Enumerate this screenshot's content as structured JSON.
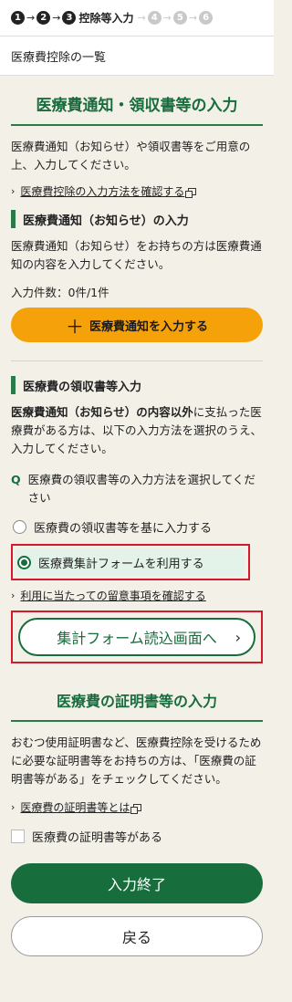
{
  "steps": [
    {
      "num": "1",
      "active": true
    },
    {
      "num": "2",
      "active": true
    },
    {
      "num": "3",
      "active": true,
      "label": "控除等入力"
    },
    {
      "num": "4",
      "active": false
    },
    {
      "num": "5",
      "active": false
    },
    {
      "num": "6",
      "active": false
    }
  ],
  "breadcrumb": "医療費控除の一覧",
  "notice_section": {
    "title": "医療費通知・領収書等の入力",
    "intro": "医療費通知（お知らせ）や領収書等をご用意の上、入力してください。",
    "link_how_to": "医療費控除の入力方法を確認する"
  },
  "notice_sub": {
    "heading": "医療費通知（お知らせ）の入力",
    "text": "医療費通知（お知らせ）をお持ちの方は医療費通知の内容を入力してください。",
    "count": "入力件数：0件/1件",
    "input_button": "医療費通知を入力する"
  },
  "receipt_sub": {
    "heading": "医療費の領収書等入力",
    "text_bold": "医療費通知（お知らせ）の内容以外",
    "text_rest": "に支払った医療費がある方は、以下の入力方法を選択のうえ、入力してください。",
    "question_mark": "Q",
    "question": "医療費の領収書等の入力方法を選択してください",
    "option1": "医療費の領収書等を基に入力する",
    "option2": "医療費集計フォームを利用する",
    "link_notes": "利用に当たっての留意事項を確認する",
    "form_button": "集計フォーム読込画面へ"
  },
  "cert_section": {
    "title": "医療費の証明書等の入力",
    "text": "おむつ使用証明書など、医療費控除を受けるために必要な証明書等をお持ちの方は、「医療費の証明書等がある」をチェックしてください。",
    "link": "医療費の証明書等とは",
    "checkbox": "医療費の証明書等がある"
  },
  "buttons": {
    "finish": "入力終了",
    "back": "戻る"
  },
  "colors": {
    "green": "#186d3c",
    "orange": "#f5a20a",
    "highlight_red": "#d21b2b",
    "background": "#f3f0e8"
  }
}
